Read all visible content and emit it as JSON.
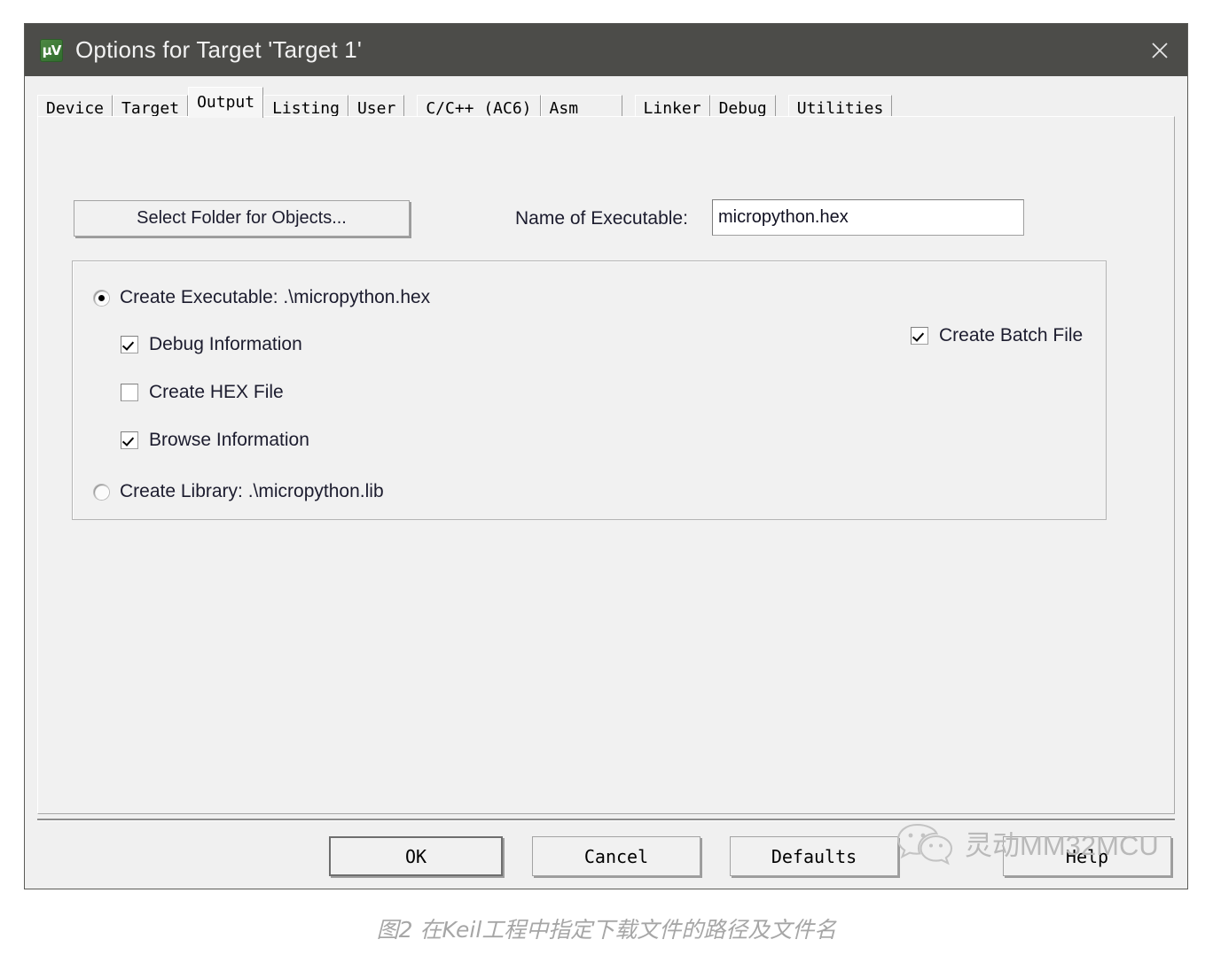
{
  "window": {
    "title": "Options for Target 'Target 1'",
    "icon": "uvision-app-icon",
    "close_icon": "close-icon",
    "titlebar_color": "#4c4c49",
    "background_color": "#f0f0f0"
  },
  "tabs": [
    {
      "label": "Device",
      "selected": false
    },
    {
      "label": "Target",
      "selected": false
    },
    {
      "label": "Output",
      "selected": true
    },
    {
      "label": "Listing",
      "selected": false
    },
    {
      "label": "User",
      "selected": false
    },
    {
      "label": "C/C++ (AC6)",
      "selected": false
    },
    {
      "label": "Asm",
      "selected": false
    },
    {
      "label": "Linker",
      "selected": false
    },
    {
      "label": "Debug",
      "selected": false
    },
    {
      "label": "Utilities",
      "selected": false
    }
  ],
  "output_page": {
    "select_folder_button": "Select Folder for Objects...",
    "name_of_executable_label": "Name of Executable:",
    "name_of_executable_value": "micropython.hex",
    "name_of_executable_placeholder": "",
    "create_executable": {
      "label": "Create Executable:  .\\micropython.hex",
      "checked": true,
      "control": "radio"
    },
    "create_library": {
      "label": "Create Library:  .\\micropython.lib",
      "checked": false,
      "control": "radio"
    },
    "checkboxes": [
      {
        "label": "Debug Information",
        "checked": true
      },
      {
        "label": "Create HEX File",
        "checked": false
      },
      {
        "label": "Browse Information",
        "checked": true
      }
    ],
    "create_batch_file": {
      "label": "Create Batch File",
      "checked": true
    }
  },
  "footer": {
    "ok": "OK",
    "cancel": "Cancel",
    "defaults": "Defaults",
    "help": "Help"
  },
  "watermark": {
    "text": "灵动MM32MCU",
    "icon": "wechat-icon",
    "color": "#b9b9b9"
  },
  "caption": "图2 在Keil工程中指定下载文件的路径及文件名"
}
